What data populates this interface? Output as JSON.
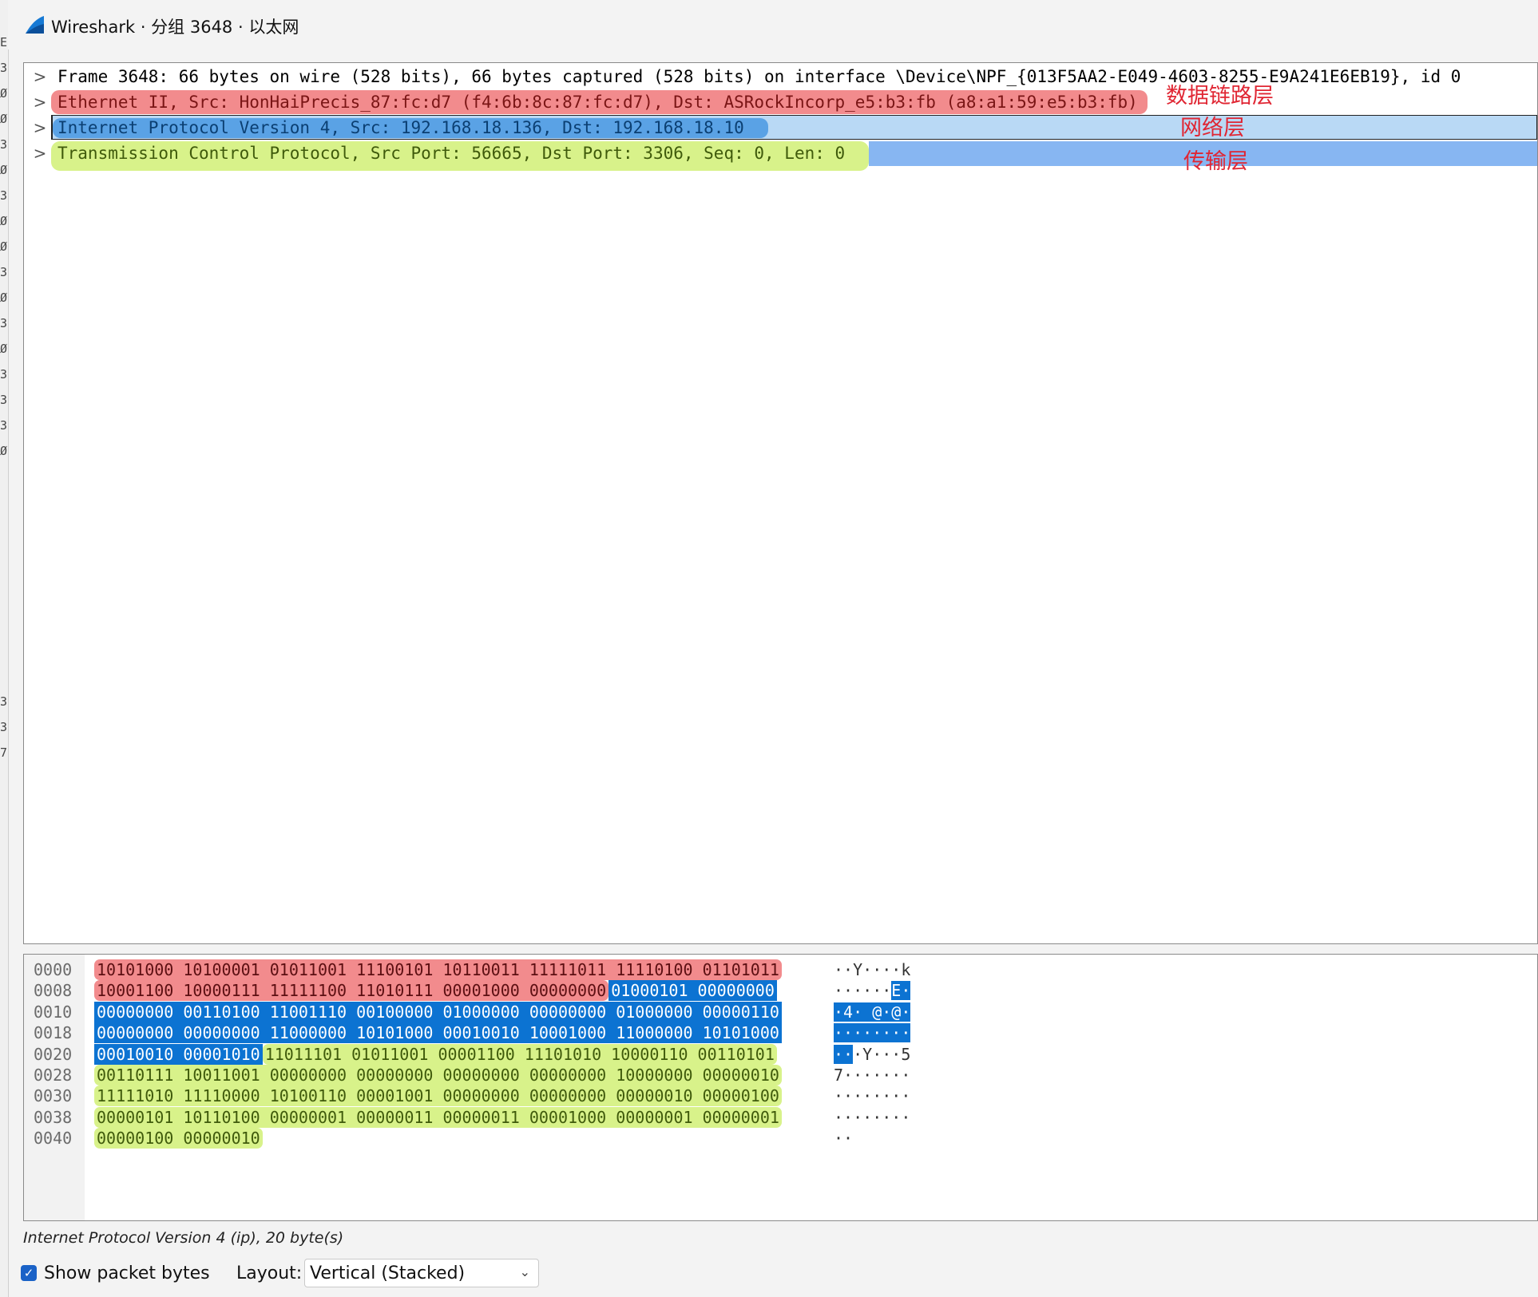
{
  "window": {
    "title": "Wireshark · 分组 3648 · 以太网"
  },
  "left_edge_glyphs": [
    "E",
    "3",
    "Ø",
    "Ø",
    "3",
    "Ø",
    "3",
    "Ø",
    "Ø",
    "3",
    "Ø",
    "3",
    "Ø",
    "3",
    "3",
    "3",
    "Ø",
    "3",
    "3",
    "7"
  ],
  "tree": {
    "frame": "Frame 3648: 66 bytes on wire (528 bits), 66 bytes captured (528 bits) on interface \\Device\\NPF_{013F5AA2-E049-4603-8255-E9A241E6EB19}, id 0",
    "ethernet": "Ethernet II, Src: HonHaiPrecis_87:fc:d7 (f4:6b:8c:87:fc:d7), Dst: ASRockIncorp_e5:b3:fb (a8:a1:59:e5:b3:fb)",
    "ip": "Internet Protocol Version 4, Src: 192.168.18.136, Dst: 192.168.18.10",
    "tcp": "Transmission Control Protocol, Src Port: 56665, Dst Port: 3306, Seq: 0, Len: 0",
    "expand_glyph": ">"
  },
  "annotations": {
    "link_layer": "数据链路层",
    "network_layer": "网络层",
    "transport_layer": "传输层"
  },
  "bytes": {
    "rows": [
      {
        "offset": "0000",
        "ascii": "··Y····k"
      },
      {
        "offset": "0008",
        "ascii": "······E·"
      },
      {
        "offset": "0010",
        "ascii": "·4· @·@·"
      },
      {
        "offset": "0018",
        "ascii": "········"
      },
      {
        "offset": "0020",
        "ascii": "···Y···5"
      },
      {
        "offset": "0028",
        "ascii": "7·······"
      },
      {
        "offset": "0030",
        "ascii": "········"
      },
      {
        "offset": "0038",
        "ascii": "········"
      },
      {
        "offset": "0040",
        "ascii": "··"
      }
    ],
    "values": [
      "10101000",
      "10100001",
      "01011001",
      "11100101",
      "10110011",
      "11111011",
      "11110100",
      "01101011",
      "10001100",
      "10000111",
      "11111100",
      "11010111",
      "00001000",
      "00000000",
      "01000101",
      "00000000",
      "00000000",
      "00110100",
      "11001110",
      "00100000",
      "01000000",
      "00000000",
      "01000000",
      "00000110",
      "00000000",
      "00000000",
      "11000000",
      "10101000",
      "00010010",
      "10001000",
      "11000000",
      "10101000",
      "00010010",
      "00001010",
      "11011101",
      "01011001",
      "00001100",
      "11101010",
      "10000110",
      "00110101",
      "00110111",
      "10011001",
      "00000000",
      "00000000",
      "00000000",
      "00000000",
      "10000000",
      "00000010",
      "11111010",
      "11110000",
      "10100110",
      "00001001",
      "00000000",
      "00000000",
      "00000010",
      "00000100",
      "00000101",
      "10110100",
      "00000001",
      "00000011",
      "00000011",
      "00001000",
      "00000001",
      "00000001",
      "00000100",
      "00000010"
    ],
    "layers": {
      "ethernet_bytes": 14,
      "ip_bytes": 20
    }
  },
  "status": {
    "text": "Internet Protocol Version 4 (ip), 20 byte(s)"
  },
  "footer": {
    "show_bytes_label": "Show packet bytes",
    "show_bytes_checked": true,
    "layout_label": "Layout:",
    "layout_value": "Vertical (Stacked)"
  },
  "colors": {
    "ethernet": "#f28b8d",
    "ip_selected": "#0c73d2",
    "tcp": "#d8f28a",
    "annotation": "#e02633"
  }
}
